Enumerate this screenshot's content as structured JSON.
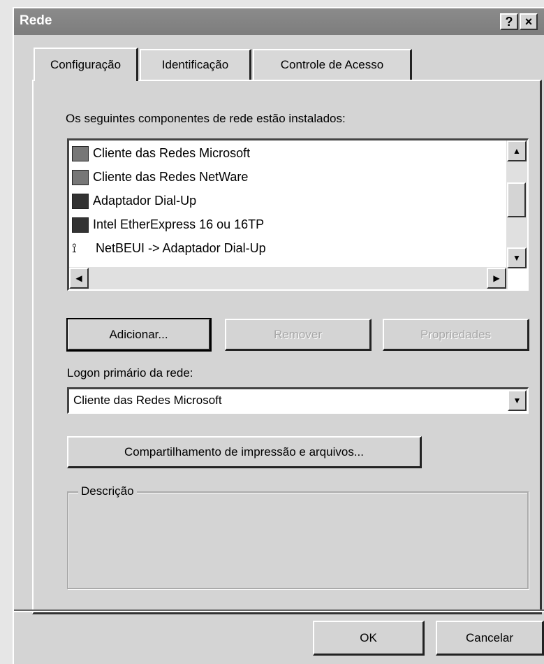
{
  "window": {
    "title": "Rede"
  },
  "titlebar": {
    "help": "?",
    "close": "×"
  },
  "tabs": [
    {
      "label": "Configuração",
      "active": true
    },
    {
      "label": "Identificação",
      "active": false
    },
    {
      "label": "Controle de Acesso",
      "active": false
    }
  ],
  "components": {
    "label": "Os seguintes componentes de rede estão instalados:",
    "items": [
      {
        "label": "Cliente das Redes Microsoft",
        "icon": "client-icon"
      },
      {
        "label": "Cliente das Redes NetWare",
        "icon": "client-icon"
      },
      {
        "label": "Adaptador Dial-Up",
        "icon": "network-adapter-icon"
      },
      {
        "label": "Intel EtherExpress 16 ou 16TP",
        "icon": "network-adapter-icon"
      },
      {
        "label": "NetBEUI -> Adaptador Dial-Up",
        "icon": "protocol-icon"
      }
    ]
  },
  "buttons": {
    "add": "Adicionar...",
    "remove": "Remover",
    "properties": "Propriedades"
  },
  "logon": {
    "label": "Logon primário da rede:",
    "value": "Cliente das Redes Microsoft"
  },
  "sharing_button": "Compartilhamento de impressão e arquivos...",
  "description": {
    "legend": "Descrição",
    "text": ""
  },
  "dialog_buttons": {
    "ok": "OK",
    "cancel": "Cancelar"
  }
}
